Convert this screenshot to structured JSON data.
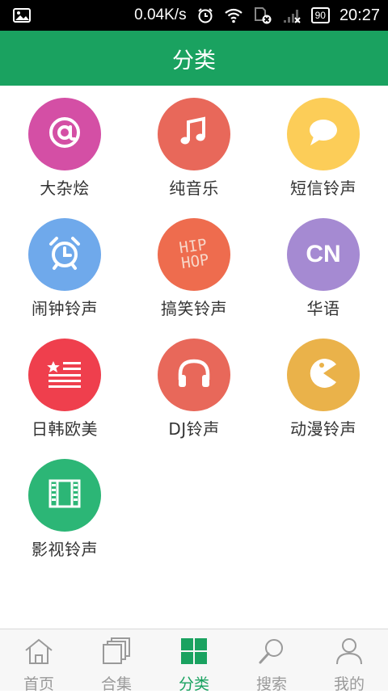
{
  "statusbar": {
    "network_speed": "0.04K/s",
    "battery_level": "90",
    "time": "20:27"
  },
  "header": {
    "title": "分类"
  },
  "categories": [
    {
      "label": "大杂烩",
      "icon": "at-sign-icon",
      "color": "#d44fa5"
    },
    {
      "label": "纯音乐",
      "icon": "music-note-icon",
      "color": "#e8685a"
    },
    {
      "label": "短信铃声",
      "icon": "chat-bubble-icon",
      "color": "#fccd58"
    },
    {
      "label": "闹钟铃声",
      "icon": "alarm-clock-icon",
      "color": "#6fa9eb"
    },
    {
      "label": "搞笑铃声",
      "icon": "hiphop-icon",
      "icon_text": [
        "HIP",
        "HOP"
      ],
      "color": "#ee6c4e"
    },
    {
      "label": "华语",
      "icon": "cn-icon",
      "icon_text": [
        "CN"
      ],
      "color": "#a58ad2"
    },
    {
      "label": "日韩欧美",
      "icon": "flag-icon",
      "color": "#ef3f4d"
    },
    {
      "label": "DJ铃声",
      "icon": "headphones-icon",
      "color": "#e8685a"
    },
    {
      "label": "动漫铃声",
      "icon": "pacman-icon",
      "color": "#eab24a"
    },
    {
      "label": "影视铃声",
      "icon": "film-icon",
      "color": "#2cb676"
    }
  ],
  "bottom_nav": [
    {
      "label": "首页",
      "icon": "home-icon",
      "active": false
    },
    {
      "label": "合集",
      "icon": "collection-icon",
      "active": false
    },
    {
      "label": "分类",
      "icon": "grid-icon",
      "active": true
    },
    {
      "label": "搜索",
      "icon": "search-icon",
      "active": false
    },
    {
      "label": "我的",
      "icon": "user-icon",
      "active": false
    }
  ],
  "colors": {
    "accent": "#1aa260",
    "status_bar": "#000000",
    "nav_inactive": "#9a9a9a"
  }
}
